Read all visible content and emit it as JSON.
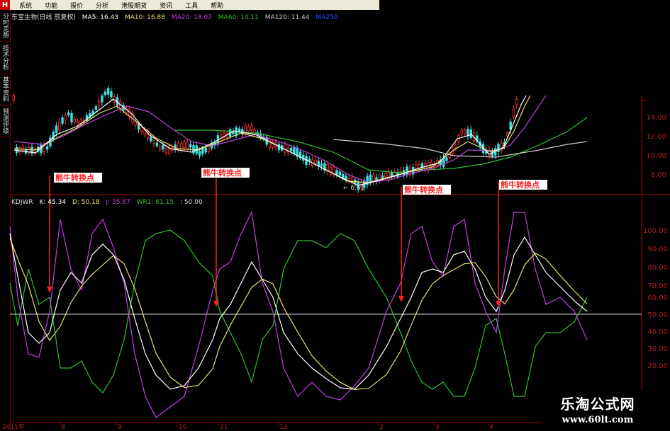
{
  "menu": {
    "logo": "H",
    "items": [
      "系统",
      "功能",
      "报价",
      "分析",
      "港股期货",
      "资讯",
      "工具",
      "帮助"
    ]
  },
  "sidebar": {
    "tabs": [
      "分时走势",
      "技术分析",
      "基本资料",
      "预测评级"
    ]
  },
  "stock_info": {
    "name": "东宝生物(日线 前复权)",
    "ma5": "MA5: 16.43",
    "ma10": "MA10: 16.88",
    "ma20": "MA20: 18.07",
    "ma60": "MA60: 14.11",
    "ma120": "MA120: 11.44",
    "ma250": "MA250"
  },
  "kdj_info": {
    "name": "KDJWR",
    "k": "K: 45.34",
    "d": "D: 50.18",
    "j": "J: 35.67",
    "wr1": "WR1: 61.15",
    "level": ": 50.00"
  },
  "colors": {
    "k_line": "#ffffff",
    "d_line": "#e8e070",
    "j_line": "#c040e0",
    "wr_line": "#30c030",
    "ma5": "#ffffff",
    "ma10": "#e8e070",
    "ma20": "#c040e0",
    "ma60": "#30c030",
    "ma120": "#cccccc",
    "up_candle": "#ff3030",
    "down_candle": "#40e0e0",
    "annotation": "#ff2020",
    "axis_red": "#aa0000"
  },
  "price_axis": {
    "ticks": [
      "14.00",
      "12.00",
      "10.00",
      "8.00"
    ]
  },
  "kdj_axis": {
    "ticks": [
      "100.00",
      "90.00",
      "80.00",
      "70.00",
      "60.00",
      "50.00",
      "40.00",
      "30.00",
      "20.00"
    ]
  },
  "time_axis": {
    "ticks": [
      "2011年",
      "8",
      "9",
      "10",
      "11",
      "12",
      "2",
      "3",
      "4"
    ]
  },
  "annotations": {
    "text": "熊牛转换点"
  },
  "low_label": "← 6.51",
  "watermark": {
    "title": "乐淘公式网",
    "url": "www.60lt.com"
  }
}
